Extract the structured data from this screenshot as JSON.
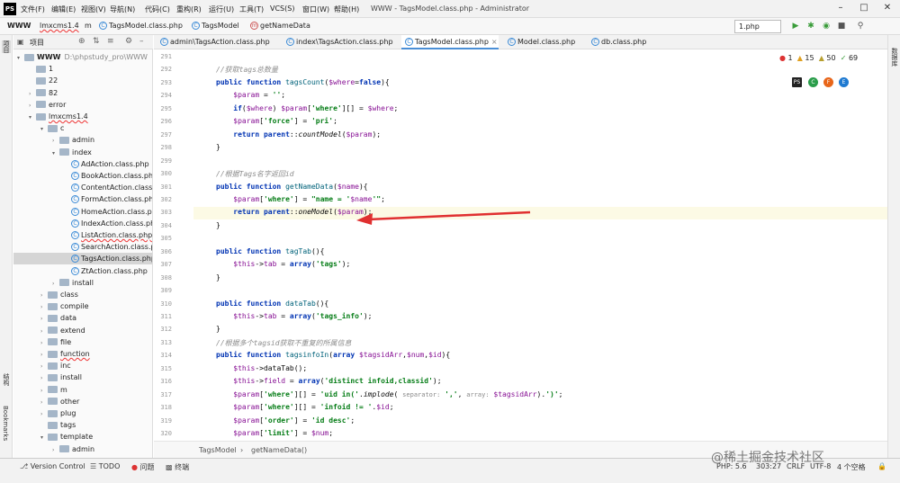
{
  "app": {
    "logo": "PS",
    "title": "WWW - TagsModel.class.php - Administrator"
  },
  "menu": [
    "文件(F)",
    "编辑(E)",
    "视图(V)",
    "导航(N)",
    "代码(C)",
    "重构(R)",
    "运行(U)",
    "工具(T)",
    "VCS(S)",
    "窗口(W)",
    "帮助(H)"
  ],
  "navbar": {
    "root": "WWW",
    "p1": "lmxcms1.4",
    "p2": "m",
    "p3": "TagsModel.class.php",
    "p4": "TagsModel",
    "p5": "getNameData",
    "run_config": "1.php"
  },
  "sidebar": {
    "left_labels": [
      "项目",
      "结构",
      "Bookmarks"
    ],
    "right_labels": [
      "数据库"
    ]
  },
  "project": {
    "label": "项目",
    "tree": [
      {
        "indent": 0,
        "arrow": "▾",
        "text": "WWW",
        "path": "D:\\phpstudy_pro\\WWW",
        "folder": true,
        "bold": true
      },
      {
        "indent": 1,
        "arrow": "",
        "text": "1",
        "folder": true
      },
      {
        "indent": 1,
        "arrow": "",
        "text": "22",
        "folder": true
      },
      {
        "indent": 1,
        "arrow": "›",
        "text": "82",
        "folder": true
      },
      {
        "indent": 1,
        "arrow": "›",
        "text": "error",
        "folder": true
      },
      {
        "indent": 1,
        "arrow": "▾",
        "text": "lmxcms1.4",
        "folder": true,
        "err": true
      },
      {
        "indent": 2,
        "arrow": "▾",
        "text": "c",
        "folder": true
      },
      {
        "indent": 3,
        "arrow": "›",
        "text": "admin",
        "folder": true
      },
      {
        "indent": 3,
        "arrow": "▾",
        "text": "index",
        "folder": true
      },
      {
        "indent": 4,
        "arrow": "",
        "text": "AdAction.class.php",
        "cls": true
      },
      {
        "indent": 4,
        "arrow": "",
        "text": "BookAction.class.php",
        "cls": true
      },
      {
        "indent": 4,
        "arrow": "",
        "text": "ContentAction.class.php",
        "cls": true
      },
      {
        "indent": 4,
        "arrow": "",
        "text": "FormAction.class.php",
        "cls": true
      },
      {
        "indent": 4,
        "arrow": "",
        "text": "HomeAction.class.php",
        "cls": true
      },
      {
        "indent": 4,
        "arrow": "",
        "text": "IndexAction.class.php",
        "cls": true
      },
      {
        "indent": 4,
        "arrow": "",
        "text": "ListAction.class.php",
        "cls": true,
        "err": true
      },
      {
        "indent": 4,
        "arrow": "",
        "text": "SearchAction.class.php",
        "cls": true
      },
      {
        "indent": 4,
        "arrow": "",
        "text": "TagsAction.class.php",
        "cls": true,
        "sel": true
      },
      {
        "indent": 4,
        "arrow": "",
        "text": "ZtAction.class.php",
        "cls": true
      },
      {
        "indent": 3,
        "arrow": "›",
        "text": "install",
        "folder": true
      },
      {
        "indent": 2,
        "arrow": "›",
        "text": "class",
        "folder": true
      },
      {
        "indent": 2,
        "arrow": "›",
        "text": "compile",
        "folder": true
      },
      {
        "indent": 2,
        "arrow": "›",
        "text": "data",
        "folder": true
      },
      {
        "indent": 2,
        "arrow": "›",
        "text": "extend",
        "folder": true
      },
      {
        "indent": 2,
        "arrow": "›",
        "text": "file",
        "folder": true
      },
      {
        "indent": 2,
        "arrow": "›",
        "text": "function",
        "folder": true,
        "err": true
      },
      {
        "indent": 2,
        "arrow": "›",
        "text": "inc",
        "folder": true
      },
      {
        "indent": 2,
        "arrow": "›",
        "text": "install",
        "folder": true
      },
      {
        "indent": 2,
        "arrow": "›",
        "text": "m",
        "folder": true
      },
      {
        "indent": 2,
        "arrow": "›",
        "text": "other",
        "folder": true
      },
      {
        "indent": 2,
        "arrow": "›",
        "text": "plug",
        "folder": true
      },
      {
        "indent": 2,
        "arrow": "",
        "text": "tags",
        "folder": true
      },
      {
        "indent": 2,
        "arrow": "▾",
        "text": "template",
        "folder": true
      },
      {
        "indent": 3,
        "arrow": "›",
        "text": "admin",
        "folder": true
      }
    ]
  },
  "tabs": [
    {
      "label": "admin\\TagsAction.class.php",
      "active": false
    },
    {
      "label": "index\\TagsAction.class.php",
      "active": false
    },
    {
      "label": "TagsModel.class.php",
      "active": true
    },
    {
      "label": "Model.class.php",
      "active": false
    },
    {
      "label": "db.class.php",
      "active": false
    }
  ],
  "inspections": {
    "errors": "1",
    "warnings": "15",
    "weak": "50",
    "typos": "69"
  },
  "browsers": [
    "PS",
    "C",
    "F",
    "E"
  ],
  "code": [
    {
      "n": "291",
      "html": ""
    },
    {
      "n": "292",
      "html": "<span class='cm'>//获取tags总数量</span>"
    },
    {
      "n": "293",
      "html": "<span class='kw'>public function</span> <span class='fn'>tagsCount</span>(<span class='vr'>$where</span>=<span class='kw'>false</span>){"
    },
    {
      "n": "294",
      "html": "    <span class='vr'>$param</span> = <span class='st'>''</span>;"
    },
    {
      "n": "295",
      "html": "    <span class='kw'>if</span>(<span class='vr'>$where</span>) <span class='vr'>$param</span>[<span class='st'>'where'</span>][] = <span class='vr'>$where</span>;"
    },
    {
      "n": "296",
      "html": "    <span class='vr'>$param</span>[<span class='st'>'force'</span>] = <span class='st'>'pri'</span>;"
    },
    {
      "n": "297",
      "html": "    <span class='kw'>return parent</span>::<span class='it'>countModel</span>(<span class='vr'>$param</span>);"
    },
    {
      "n": "298",
      "html": "}"
    },
    {
      "n": "299",
      "html": ""
    },
    {
      "n": "300",
      "html": "<span class='cm'>//根据Tags名字返回id</span>"
    },
    {
      "n": "301",
      "html": "<span class='kw'>public function</span> <span class='fn'>getNameData</span>(<span class='vr'>$name</span>){"
    },
    {
      "n": "302",
      "html": "    <span class='vr'>$param</span>[<span class='st'>'where'</span>] = <span class='st'>\"name = '</span><span class='vr'>$name</span><span class='st'>'\"</span>;"
    },
    {
      "n": "303",
      "html": "    <span class='kw'>return parent</span>::<span class='it'>oneModel</span>(<span class='vr'>$param</span>);",
      "hl": true
    },
    {
      "n": "304",
      "html": "}"
    },
    {
      "n": "305",
      "html": ""
    },
    {
      "n": "306",
      "html": "<span class='kw'>public function</span> <span class='fn'>tagTab</span>(){"
    },
    {
      "n": "307",
      "html": "    <span class='vr'>$this</span>-><span class='vr'>tab</span> = <span class='kw'>array</span>(<span class='st'>'tags'</span>);"
    },
    {
      "n": "308",
      "html": "}"
    },
    {
      "n": "309",
      "html": ""
    },
    {
      "n": "310",
      "html": "<span class='kw'>public function</span> <span class='fn'>dataTab</span>(){"
    },
    {
      "n": "311",
      "html": "    <span class='vr'>$this</span>-><span class='vr'>tab</span> = <span class='kw'>array</span>(<span class='st'>'tags_info'</span>);"
    },
    {
      "n": "312",
      "html": "}"
    },
    {
      "n": "313",
      "html": "<span class='cm'>//根据多个tagsid获取不重复的所属信息</span>"
    },
    {
      "n": "314",
      "html": "<span class='kw'>public function</span> <span class='fn'>tagsinfoIn</span>(<span class='kw'>array</span> <span class='vr'>$tagsidArr</span>,<span class='vr'>$num</span>,<span class='vr'>$id</span>){"
    },
    {
      "n": "315",
      "html": "    <span class='vr'>$this</span>->dataTab();"
    },
    {
      "n": "316",
      "html": "    <span class='vr'>$this</span>-><span class='vr'>field</span> = <span class='kw'>array</span>(<span class='st'>'distinct infoid,classid'</span>);"
    },
    {
      "n": "317",
      "html": "    <span class='vr'>$param</span>[<span class='st'>'where'</span>][] = <span class='st'>'uid in('</span>.<span class='it'>implode</span>( <span class='hint'>separator:</span> <span class='st'>','</span>, <span class='hint'>array:</span> <span class='vr'>$tagsidArr</span>).<span class='st'>')'</span>;"
    },
    {
      "n": "318",
      "html": "    <span class='vr'>$param</span>[<span class='st'>'where'</span>][] = <span class='st'>'infoid != '</span>.<span class='vr'>$id</span>;"
    },
    {
      "n": "319",
      "html": "    <span class='vr'>$param</span>[<span class='st'>'order'</span>] = <span class='st'>'id desc'</span>;"
    },
    {
      "n": "320",
      "html": "    <span class='vr'>$param</span>[<span class='st'>'limit'</span>] = <span class='vr'>$num</span>;"
    }
  ],
  "editor_breadcrumb": {
    "cls": "TagsModel",
    "fn": "getNameData()"
  },
  "status": {
    "tools": [
      "Version Control",
      "TODO",
      "问题",
      "终端"
    ],
    "right": [
      "PHP: 5.6",
      "303:27",
      "CRLF",
      "UTF-8",
      "4 个空格"
    ]
  },
  "watermark": "@稀土掘金技术社区",
  "colors": {
    "arrow": "#e03030",
    "accent": "#4a8fd6"
  }
}
